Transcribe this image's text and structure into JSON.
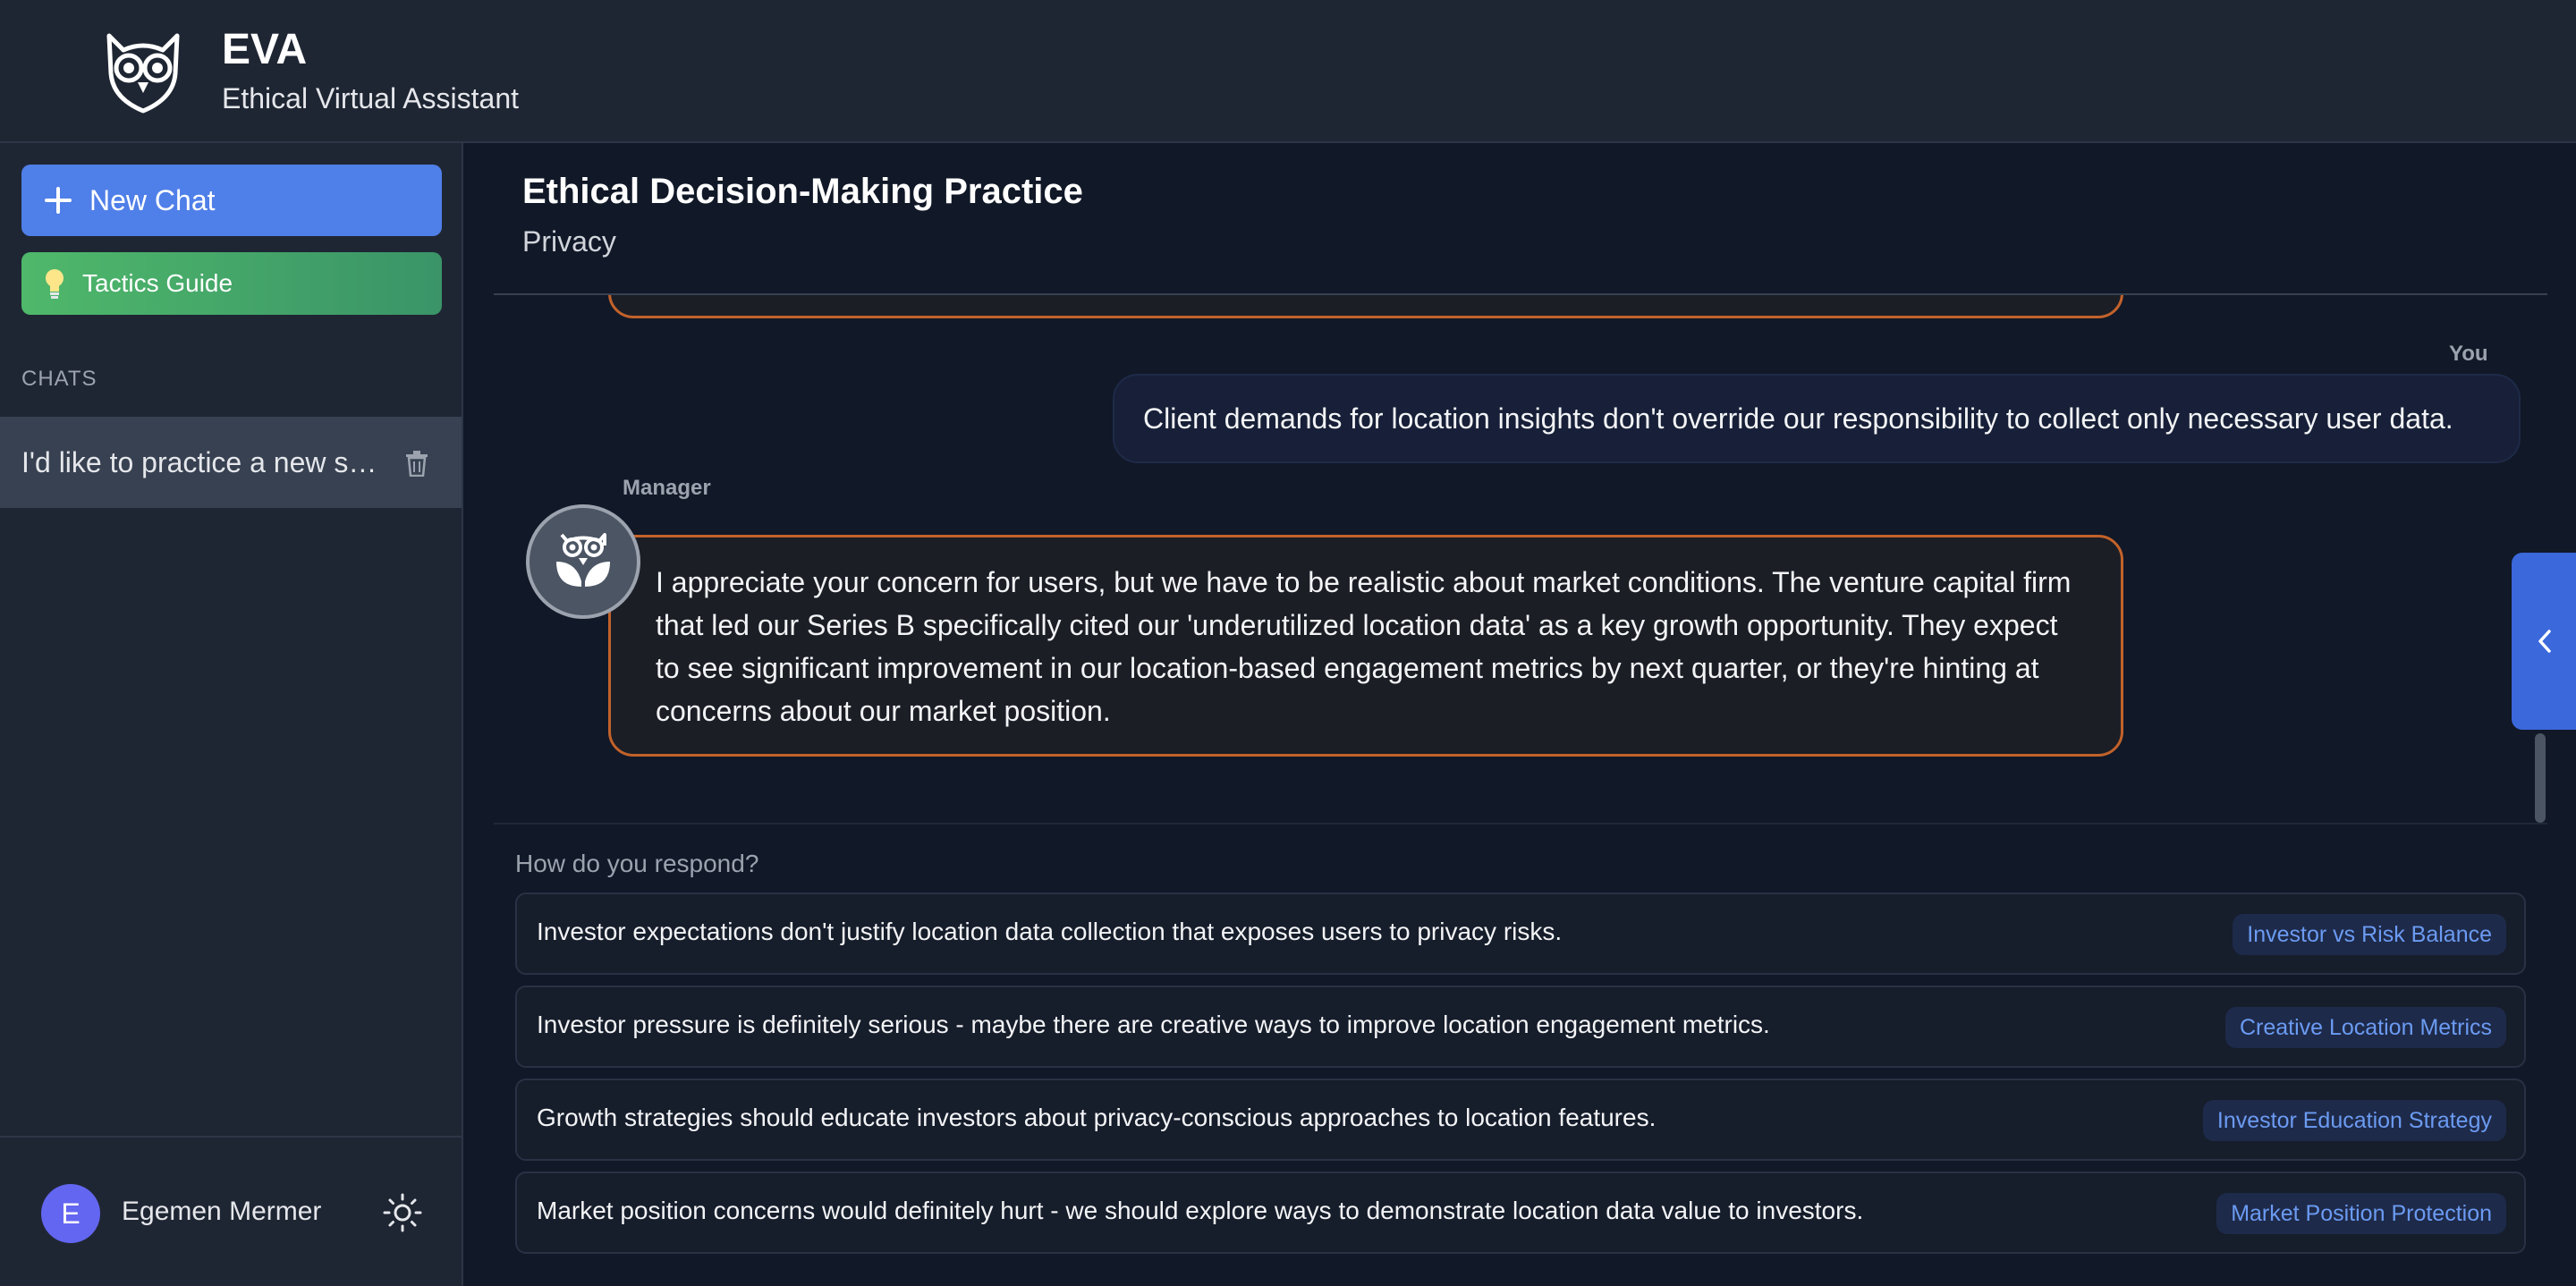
{
  "header": {
    "title": "EVA",
    "subtitle": "Ethical Virtual Assistant",
    "logo_icon": "owl-icon"
  },
  "sidebar": {
    "new_chat_label": "New Chat",
    "tactics_label": "Tactics Guide",
    "chats_heading": "CHATS",
    "chats": [
      {
        "title": "I'd like to practice a new scenario"
      }
    ],
    "user": {
      "initial": "E",
      "name": "Egemen Mermer"
    }
  },
  "main": {
    "title": "Ethical Decision-Making Practice",
    "subtitle": "Privacy",
    "messages": [
      {
        "sender": "You",
        "text": "Client demands for location insights don't override our responsibility to collect only necessary user data."
      },
      {
        "sender": "Manager",
        "text": "I appreciate your concern for users, but we have to be realistic about market conditions. The venture capital firm that led our Series B specifically cited our 'underutilized location data' as a key growth opportunity. They expect to see significant improvement in our location-based engagement metrics by next quarter, or they're hinting at concerns about our market position."
      }
    ],
    "respond_prompt": "How do you respond?",
    "options": [
      {
        "text": "Investor expectations don't justify location data collection that exposes users to privacy risks.",
        "tag": "Investor vs Risk Balance"
      },
      {
        "text": "Investor pressure is definitely serious - maybe there are creative ways to improve location engagement metrics.",
        "tag": "Creative Location Metrics"
      },
      {
        "text": "Growth strategies should educate investors about privacy-conscious approaches to location features.",
        "tag": "Investor Education Strategy"
      },
      {
        "text": "Market position concerns would definitely hurt - we should explore ways to demonstrate location data value to investors.",
        "tag": "Market Position Protection"
      }
    ]
  },
  "colors": {
    "accent_blue": "#4f7fe8",
    "accent_green": "#4fb86a",
    "manager_border": "#c2622a",
    "tag_text": "#6b9bf2"
  }
}
